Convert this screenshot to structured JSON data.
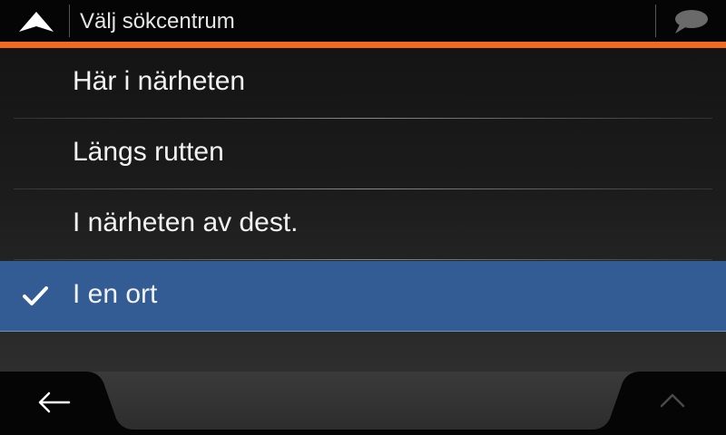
{
  "header": {
    "title": "Välj sökcentrum",
    "nav_icon": "navigation-arrow-icon",
    "chat_icon": "chat-bubble-icon",
    "accent_color": "#f26a1b"
  },
  "list": {
    "items": [
      {
        "label": "Här i närheten",
        "selected": false
      },
      {
        "label": "Längs rutten",
        "selected": false
      },
      {
        "label": "I närheten av dest.",
        "selected": false
      },
      {
        "label": "I en ort",
        "selected": true
      }
    ],
    "selected_color": "#335c94",
    "check_icon": "checkmark-icon"
  },
  "footer": {
    "back_icon": "back-arrow-icon",
    "up_icon": "chevron-up-icon"
  }
}
